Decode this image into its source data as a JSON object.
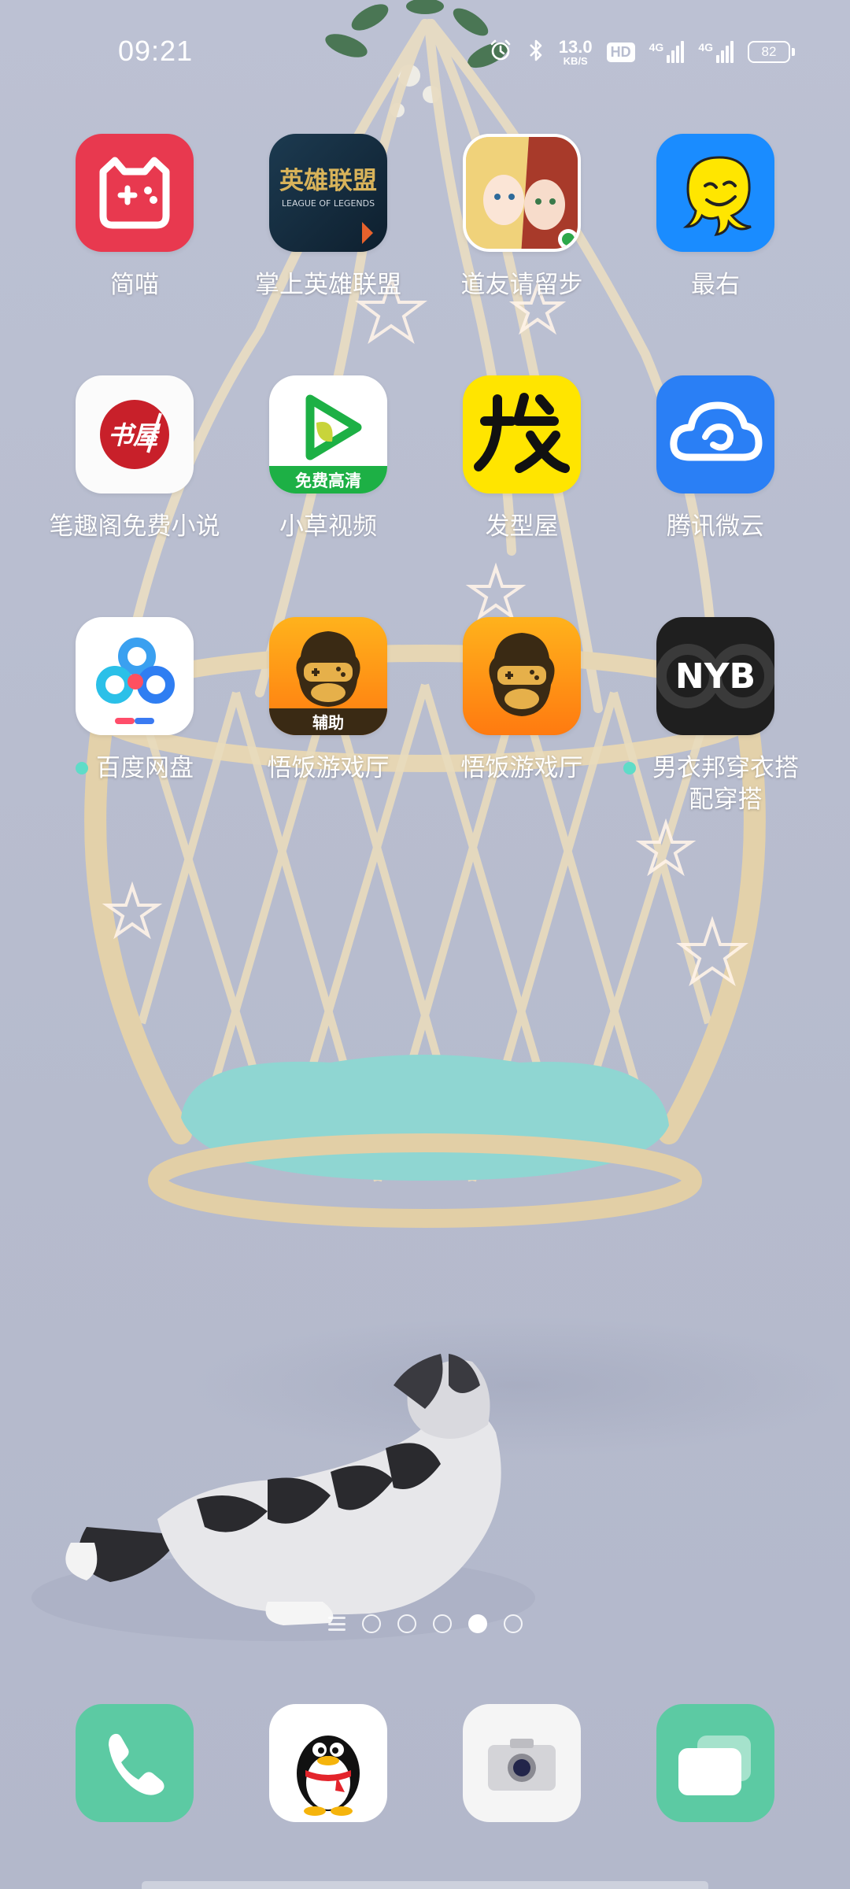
{
  "status_bar": {
    "time": "09:21",
    "net_speed_value": "13.0",
    "net_speed_unit": "KB/S",
    "hd_badge": "HD",
    "signal_1_label": "4G",
    "signal_2_label": "4G",
    "battery_level": "82",
    "icons": [
      "alarm-icon",
      "bluetooth-icon",
      "signal-icon",
      "battery-icon"
    ]
  },
  "apps": [
    {
      "label": "简喵",
      "icon": "jianmiao-icon",
      "dot": false
    },
    {
      "label": "掌上英雄联盟",
      "icon": "lol-icon",
      "dot": false,
      "icon_text": "英雄联盟",
      "icon_subtext": "LEAGUE OF LEGENDS"
    },
    {
      "label": "道友请留步",
      "icon": "daoyou-icon",
      "dot": false
    },
    {
      "label": "最右",
      "icon": "zuiyou-icon",
      "dot": false
    },
    {
      "label": "笔趣阁免费小说",
      "icon": "biquge-icon",
      "dot": false,
      "icon_text": "书屋"
    },
    {
      "label": "小草视频",
      "icon": "xiaocao-icon",
      "dot": false,
      "icon_text": "免费高清"
    },
    {
      "label": "发型屋",
      "icon": "faxingwu-icon",
      "dot": false,
      "icon_text": "发"
    },
    {
      "label": "腾讯微云",
      "icon": "weiyun-icon",
      "dot": false
    },
    {
      "label": "百度网盘",
      "icon": "baidu-netdisk-icon",
      "dot": true
    },
    {
      "label": "悟饭游戏厅",
      "icon": "wufan-helper-icon",
      "dot": false,
      "icon_text": "辅助"
    },
    {
      "label": "悟饭游戏厅",
      "icon": "wufan-icon",
      "dot": false
    },
    {
      "label": "男衣邦穿衣搭配穿搭",
      "icon": "nyb-icon",
      "dot": true,
      "icon_text": "NYB"
    }
  ],
  "page_indicator": {
    "total_dots": 5,
    "active_index": 3
  },
  "dock": [
    {
      "name": "phone-app",
      "icon": "phone-icon"
    },
    {
      "name": "qq-app",
      "icon": "qq-penguin-icon"
    },
    {
      "name": "camera-app",
      "icon": "camera-icon"
    },
    {
      "name": "messages-app",
      "icon": "messages-icon"
    }
  ],
  "colors": {
    "wallpaper": "#b8bdd0",
    "notification_dot": "#5fdcc8",
    "jianmiao": "#e8394f",
    "zuiyou": "#1a8cff",
    "weiyun": "#2a7ff5",
    "faxingwu": "#ffe500",
    "phone": "#5ccaa3",
    "messages": "#5ccaa3"
  }
}
